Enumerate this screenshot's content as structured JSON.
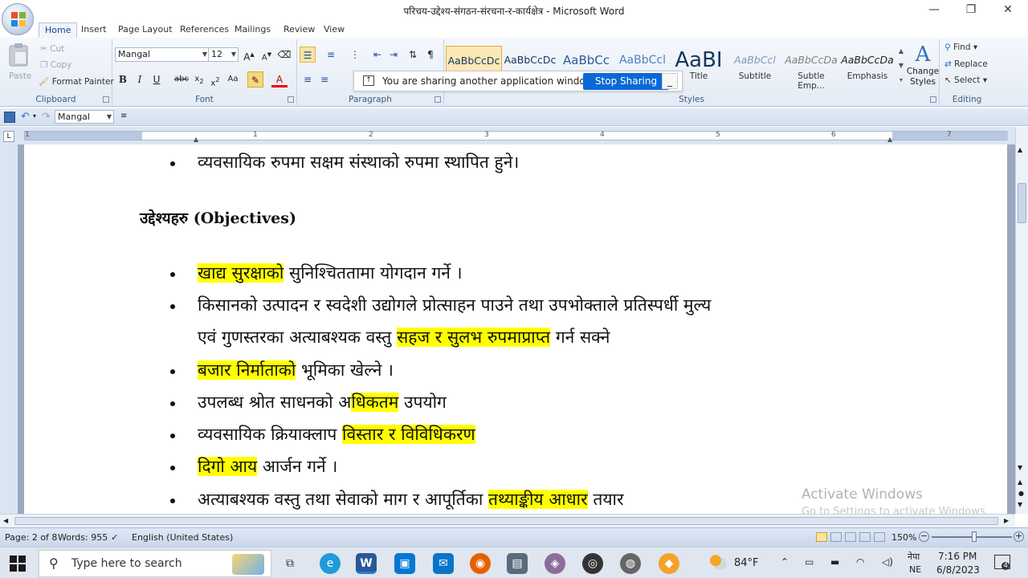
{
  "window": {
    "title": "परिचय-उद्देश्य-संगठन-संरचना-र-कार्यक्षेत्र - Microsoft Word",
    "minimize": "—",
    "maximize": "❐",
    "close": "✕"
  },
  "ribbon_tabs": [
    "Home",
    "Insert",
    "Page Layout",
    "References",
    "Mailings",
    "Review",
    "View"
  ],
  "clipboard": {
    "label": "Clipboard",
    "paste": "Paste",
    "cut": "Cut",
    "copy": "Copy",
    "format_painter": "Format Painter"
  },
  "font": {
    "label": "Font",
    "family": "Mangal",
    "size": "12"
  },
  "paragraph": {
    "label": "Paragraph"
  },
  "styles": {
    "label": "Styles",
    "items": [
      {
        "sample": "AaBbCcDc",
        "name": ""
      },
      {
        "sample": "AaBbCcDc",
        "name": ""
      },
      {
        "sample": "AaBbCc",
        "name": ""
      },
      {
        "sample": "AaBbCcl",
        "name": ""
      },
      {
        "sample": "AaBI",
        "name": "Title"
      },
      {
        "sample": "AaBbCcl",
        "name": "Subtitle"
      },
      {
        "sample": "AaBbCcDa",
        "name": "Subtle Emp..."
      },
      {
        "sample": "AaBbCcDa",
        "name": "Emphasis"
      }
    ],
    "change_styles": "Change Styles"
  },
  "editing": {
    "label": "Editing",
    "find": "Find",
    "replace": "Replace",
    "select": "Select"
  },
  "share_bar": {
    "message": "You are sharing another application window.",
    "stop": "Stop Sharing"
  },
  "qat": {
    "font": "Mangal"
  },
  "ruler": {
    "numbers": [
      "1",
      "1",
      "2",
      "3",
      "4",
      "5",
      "6",
      "7"
    ]
  },
  "document": {
    "lines": [
      {
        "kind": "bullet",
        "segments": [
          {
            "text": "व्यवसायिक रुपमा सक्षम संस्थाको रुपमा स्थापित हुने।",
            "hl": false
          }
        ]
      },
      {
        "kind": "heading",
        "segments": [
          {
            "text": "उद्देश्यहरु (Objectives)",
            "hl": false
          }
        ]
      },
      {
        "kind": "bullet",
        "segments": [
          {
            "text": "खाद्य सुरक्षाको",
            "hl": true
          },
          {
            "text": " सुनिश्चिततामा योगदान गर्ने ।",
            "hl": false
          }
        ]
      },
      {
        "kind": "bullet",
        "segments": [
          {
            "text": "किसानको उत्पादन र स्वदेशी उद्योगले प्रोत्साहन पाउने तथा उपभोक्ताले प्रतिस्पर्धी मुल्य",
            "hl": false
          }
        ]
      },
      {
        "kind": "cont",
        "segments": [
          {
            "text": "एवं गुणस्तरका अत्याबश्यक वस्तु ",
            "hl": false
          },
          {
            "text": "सहज र सुलभ रुपमाप्राप्त",
            "hl": true
          },
          {
            "text": " गर्न सक्ने",
            "hl": false
          }
        ]
      },
      {
        "kind": "bullet",
        "segments": [
          {
            "text": " ",
            "hl": false
          },
          {
            "text": "बजार निर्माताको",
            "hl": true
          },
          {
            "text": " भूमिका खेल्ने ।",
            "hl": false
          }
        ]
      },
      {
        "kind": "bullet",
        "segments": [
          {
            "text": "उपलब्ध श्रोत साधनको अ",
            "hl": false
          },
          {
            "text": "धिकतम",
            "hl": true
          },
          {
            "text": " उपयोग",
            "hl": false
          }
        ]
      },
      {
        "kind": "bullet",
        "segments": [
          {
            "text": " व्यवसायिक क्रियाक्लाप ",
            "hl": false
          },
          {
            "text": "विस्तार र विविधिकरण",
            "hl": true
          }
        ]
      },
      {
        "kind": "bullet",
        "segments": [
          {
            "text": "दिगो आय",
            "hl": true
          },
          {
            "text": " आर्जन गर्ने ।",
            "hl": false
          }
        ]
      },
      {
        "kind": "bullet",
        "segments": [
          {
            "text": "अत्याबश्यक वस्तु तथा सेवाको माग र आपूर्तिका ",
            "hl": false
          },
          {
            "text": "तथ्याङ्कीय आधार",
            "hl": true
          },
          {
            "text": " तयार",
            "hl": false
          }
        ]
      }
    ]
  },
  "watermark": {
    "line1": "Activate Windows",
    "line2": "Go to Settings to activate Windows."
  },
  "statusbar": {
    "page": "Page: 2 of 8",
    "words": "Words: 955",
    "language": "English (United States)",
    "zoom": "150%"
  },
  "taskbar": {
    "search_placeholder": "Type here to search",
    "weather": "84°F",
    "lang1": "नेपा",
    "lang2": "NE",
    "time": "7:16 PM",
    "date": "6/8/2023",
    "notifications": "4"
  }
}
